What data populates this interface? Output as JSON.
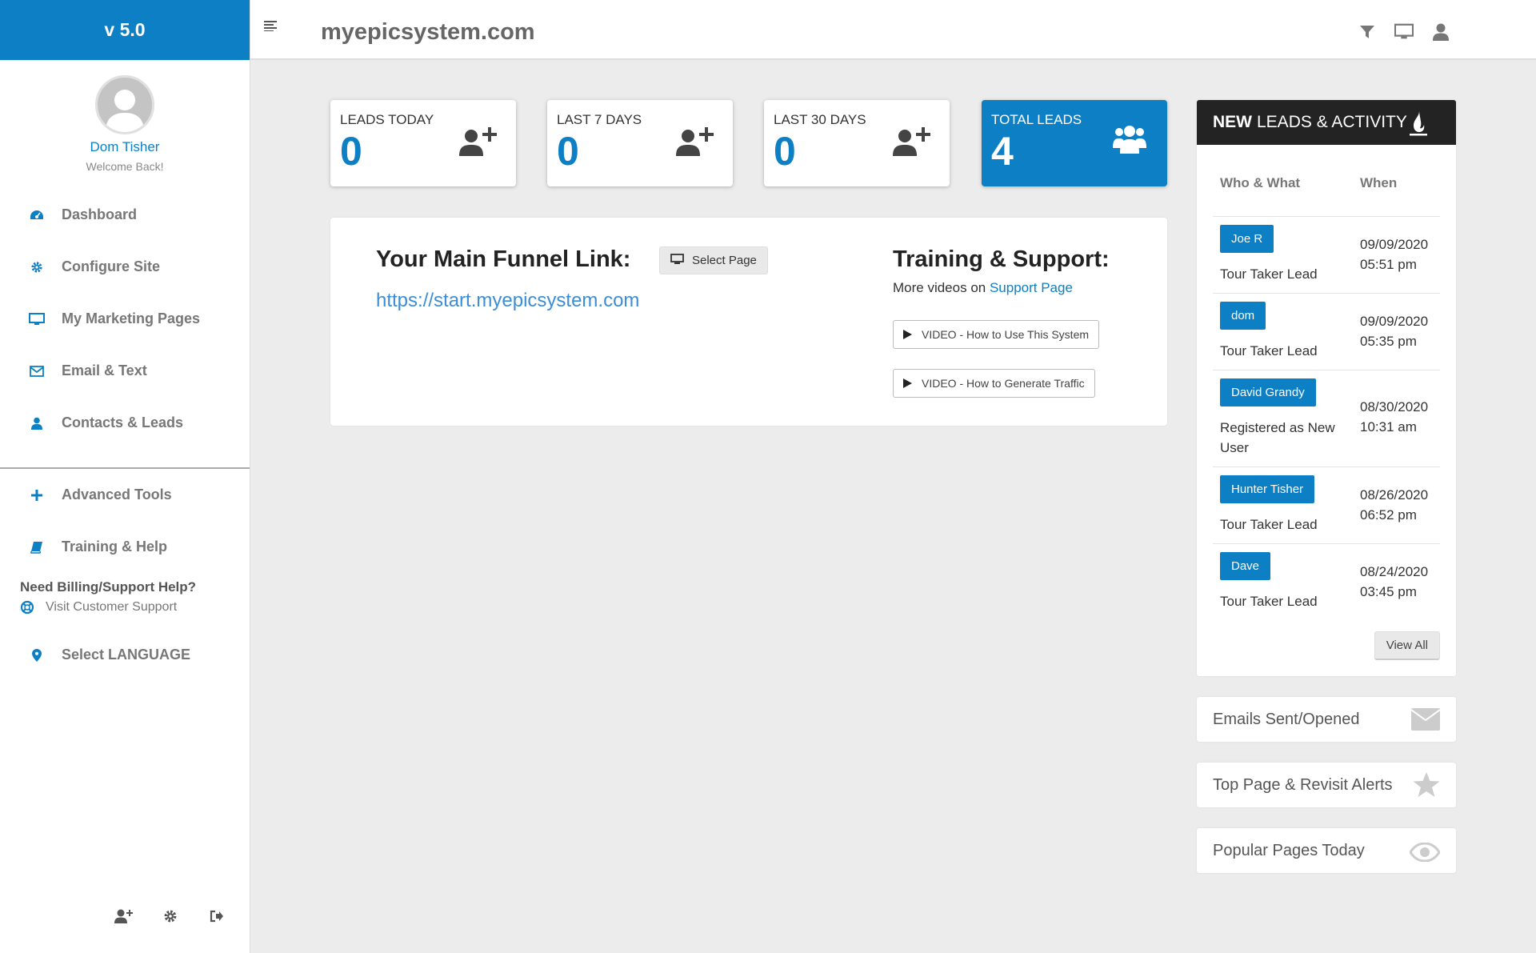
{
  "sidebar": {
    "version": "v 5.0",
    "profile": {
      "name": "Dom Tisher",
      "subtitle": "Welcome Back!"
    },
    "nav": [
      {
        "label": "Dashboard",
        "icon": "dashboard-icon"
      },
      {
        "label": "Configure Site",
        "icon": "gear-icon"
      },
      {
        "label": "My Marketing Pages",
        "icon": "monitor-icon"
      },
      {
        "label": "Email & Text",
        "icon": "envelope-icon"
      },
      {
        "label": "Contacts & Leads",
        "icon": "user-icon"
      }
    ],
    "nav2": [
      {
        "label": "Advanced Tools",
        "icon": "plus-icon"
      },
      {
        "label": "Training & Help",
        "icon": "book-icon"
      }
    ],
    "billing": {
      "title": "Need Billing/Support Help?",
      "link": "Visit Customer Support"
    },
    "language": "Select LANGUAGE",
    "footer_icons": [
      "add-user-icon",
      "gear-icon",
      "logout-icon"
    ]
  },
  "topbar": {
    "site_title": "myepicsystem.com",
    "icons": [
      "filter-icon",
      "monitor-icon",
      "user-icon"
    ]
  },
  "stats": [
    {
      "label": "LEADS TODAY",
      "value": "0",
      "icon": "add-user-icon"
    },
    {
      "label": "LAST 7 DAYS",
      "value": "0",
      "icon": "add-user-icon"
    },
    {
      "label": "LAST 30 DAYS",
      "value": "0",
      "icon": "add-user-icon"
    },
    {
      "label": "TOTAL LEADS",
      "value": "4",
      "icon": "users-group-icon"
    }
  ],
  "funnel": {
    "title": "Your Main Funnel Link:",
    "select_page": "Select Page",
    "link": "https://start.myepicsystem.com"
  },
  "training": {
    "title": "Training & Support:",
    "sub_prefix": "More videos on ",
    "sub_link": "Support Page",
    "videos": [
      "VIDEO - How to Use This System",
      "VIDEO - How to Generate Traffic"
    ]
  },
  "leads_panel": {
    "title_bold": "NEW",
    "title_rest": "LEADS & ACTIVITY",
    "col_who": "Who & What",
    "col_when": "When",
    "rows": [
      {
        "name": "Joe R",
        "what": "Tour Taker Lead",
        "date": "09/09/2020",
        "time": "05:51 pm"
      },
      {
        "name": "dom",
        "what": "Tour Taker Lead",
        "date": "09/09/2020",
        "time": "05:35 pm"
      },
      {
        "name": "David Grandy",
        "what": "Registered as New User",
        "date": "08/30/2020",
        "time": "10:31 am"
      },
      {
        "name": "Hunter Tisher",
        "what": "Tour Taker Lead",
        "date": "08/26/2020",
        "time": "06:52 pm"
      },
      {
        "name": "Dave",
        "what": "Tour Taker Lead",
        "date": "08/24/2020",
        "time": "03:45 pm"
      }
    ],
    "view_all": "View All"
  },
  "side_cards": [
    {
      "label": "Emails Sent/Opened",
      "icon": "envelope-icon"
    },
    {
      "label": "Top Page & Revisit Alerts",
      "icon": "star-icon"
    },
    {
      "label": "Popular Pages Today",
      "icon": "eye-icon"
    }
  ],
  "colors": {
    "primary": "#0d7fc4",
    "header_dark": "#232323",
    "background": "#ececec"
  }
}
